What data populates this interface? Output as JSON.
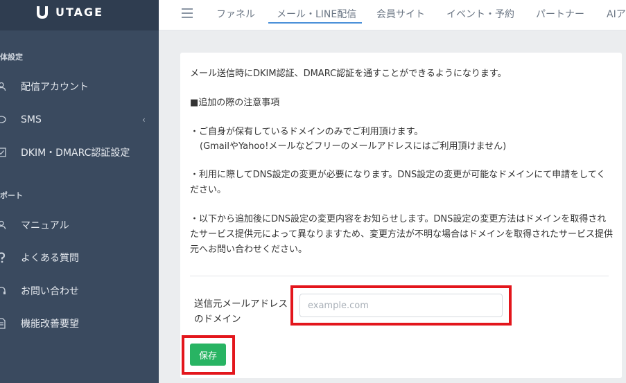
{
  "brand": {
    "name": "UTAGE"
  },
  "sidebar": {
    "section1": "体設定",
    "section2": "ポート",
    "items": [
      {
        "label": "配信アカウント",
        "icon": "user-icon"
      },
      {
        "label": "SMS",
        "icon": "sms-icon",
        "has_chevron": true,
        "chevron": "‹"
      },
      {
        "label": "DKIM・DMARC認証設定",
        "icon": "check-square-icon"
      },
      {
        "label": "マニュアル",
        "icon": "user-icon"
      },
      {
        "label": "よくある質問",
        "icon": "question-icon"
      },
      {
        "label": "お問い合わせ",
        "icon": "headset-icon"
      },
      {
        "label": "機能改善要望",
        "icon": "document-icon"
      }
    ]
  },
  "topnav": {
    "tabs": [
      {
        "label": "ファネル"
      },
      {
        "label": "メール・LINE配信",
        "active": true
      },
      {
        "label": "会員サイト"
      },
      {
        "label": "イベント・予約"
      },
      {
        "label": "パートナー"
      },
      {
        "label": "AIア"
      }
    ]
  },
  "card": {
    "intro": "メール送信時にDKIM認証、DMARC認証を通すことができるようになります。",
    "notes_heading": "■追加の際の注意事項",
    "note1_line1": "・ご自身が保有しているドメインのみでご利用頂けます。",
    "note1_line2": "(GmailやYahoo!メールなどフリーのメールアドレスにはご利用頂けません)",
    "note2": "・利用に際してDNS設定の変更が必要になります。DNS設定の変更が可能なドメインにて申請をしてください。",
    "note3": "・以下から追加後にDNS設定の変更内容をお知らせします。DNS設定の変更方法はドメインを取得されたサービス提供元によって異なりますため、変更方法が不明な場合はドメインを取得されたサービス提供元へお問い合わせください。",
    "field_label": "送信元メールアドレスのドメイン",
    "field_value": "",
    "field_placeholder": "example.com",
    "save_label": "保存"
  },
  "colors": {
    "sidebar_bg": "#3a4a5f",
    "accent_blue": "#4a90d9",
    "save_green": "#28b463",
    "highlight_red": "#e3161c"
  }
}
